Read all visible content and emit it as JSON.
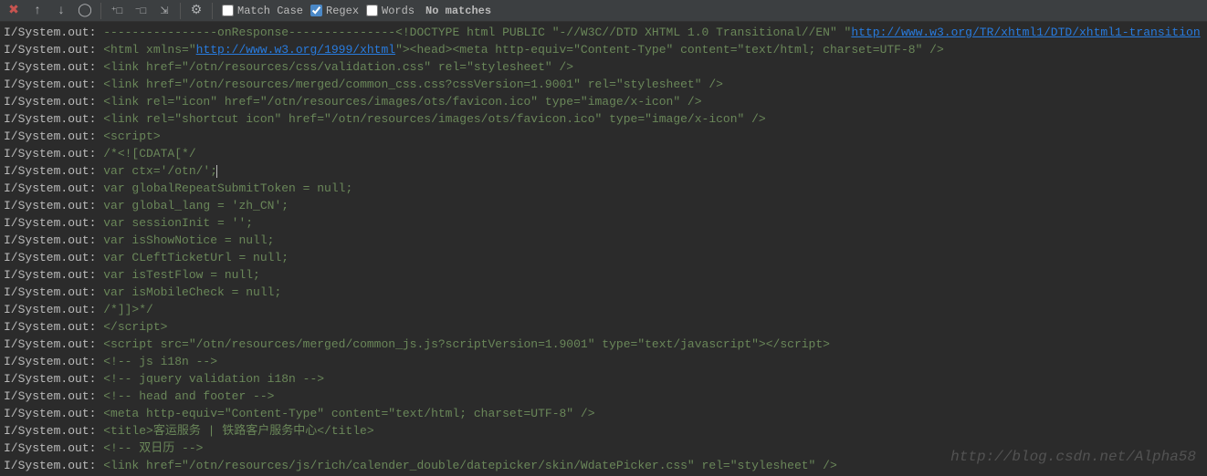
{
  "toolbar": {
    "match_case_label": "Match Case",
    "regex_label": "Regex",
    "words_label": "Words",
    "status": "No matches"
  },
  "checks": {
    "match_case": false,
    "regex": true,
    "words": false
  },
  "log_prefix": "I/System.out:",
  "lines": [
    {
      "pre": "----------------onResponse---------------<!DOCTYPE html PUBLIC \"-//W3C//DTD XHTML 1.0 Transitional//EN\" \"",
      "link": "http://www.w3.org/TR/xhtml1/DTD/xhtml1-transition",
      "post": ""
    },
    {
      "pre": "<html xmlns=\"",
      "link": "http://www.w3.org/1999/xhtml",
      "post": "\"><head><meta http-equiv=\"Content-Type\" content=\"text/html; charset=UTF-8\" />"
    },
    {
      "pre": "<link href=\"/otn/resources/css/validation.css\" rel=\"stylesheet\" />",
      "link": "",
      "post": ""
    },
    {
      "pre": "<link href=\"/otn/resources/merged/common_css.css?cssVersion=1.9001\" rel=\"stylesheet\" />",
      "link": "",
      "post": ""
    },
    {
      "pre": "<link rel=\"icon\"  href=\"/otn/resources/images/ots/favicon.ico\" type=\"image/x-icon\" />",
      "link": "",
      "post": ""
    },
    {
      "pre": "<link rel=\"shortcut icon\" href=\"/otn/resources/images/ots/favicon.ico\" type=\"image/x-icon\" />",
      "link": "",
      "post": ""
    },
    {
      "pre": "<script>",
      "link": "",
      "post": ""
    },
    {
      "pre": "/*<![CDATA[*/",
      "link": "",
      "post": ""
    },
    {
      "pre": " var ctx='/otn/';",
      "link": "",
      "post": "",
      "cursor": true
    },
    {
      "pre": " var globalRepeatSubmitToken = null;",
      "link": "",
      "post": ""
    },
    {
      "pre": " var global_lang = 'zh_CN';",
      "link": "",
      "post": ""
    },
    {
      "pre": " var sessionInit = '';",
      "link": "",
      "post": ""
    },
    {
      "pre": " var isShowNotice = null;",
      "link": "",
      "post": ""
    },
    {
      "pre": " var CLeftTicketUrl = null;",
      "link": "",
      "post": ""
    },
    {
      "pre": " var isTestFlow = null;",
      "link": "",
      "post": ""
    },
    {
      "pre": " var isMobileCheck = null;",
      "link": "",
      "post": ""
    },
    {
      "pre": " /*]]>*/",
      "link": "",
      "post": ""
    },
    {
      "pre": "</script>",
      "link": "",
      "post": ""
    },
    {
      "pre": "<script src=\"/otn/resources/merged/common_js.js?scriptVersion=1.9001\" type=\"text/javascript\"></script>",
      "link": "",
      "post": ""
    },
    {
      "pre": "<!-- js i18n -->",
      "link": "",
      "post": ""
    },
    {
      "pre": "<!-- jquery validation i18n -->",
      "link": "",
      "post": ""
    },
    {
      "pre": "<!-- head and footer -->",
      "link": "",
      "post": ""
    },
    {
      "pre": "<meta http-equiv=\"Content-Type\" content=\"text/html; charset=UTF-8\" />",
      "link": "",
      "post": ""
    },
    {
      "pre": "<title>客运服务 | 铁路客户服务中心</title>",
      "link": "",
      "post": ""
    },
    {
      "pre": "<!-- 双日历 -->",
      "link": "",
      "post": ""
    },
    {
      "pre": "<link href=\"/otn/resources/js/rich/calender_double/datepicker/skin/WdatePicker.css\" rel=\"stylesheet\" />",
      "link": "",
      "post": ""
    }
  ],
  "watermark": "http://blog.csdn.net/Alpha58"
}
